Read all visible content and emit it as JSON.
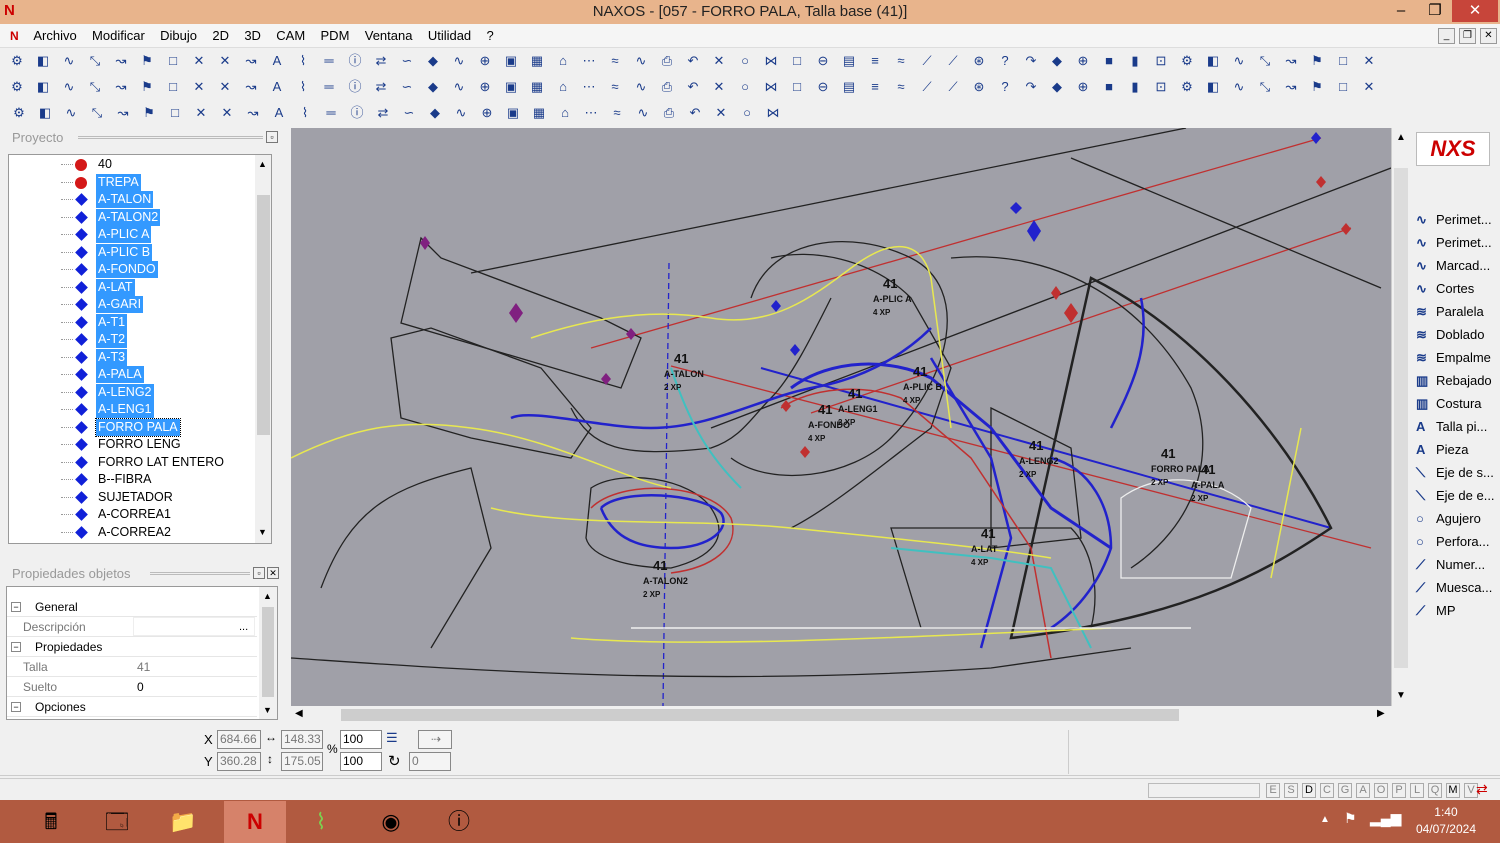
{
  "window": {
    "title": "NAXOS - [057 - FORRO PALA, Talla base (41)]",
    "app_logo": "N"
  },
  "menu": [
    "Archivo",
    "Modificar",
    "Dibujo",
    "2D",
    "3D",
    "CAM",
    "PDM",
    "Ventana",
    "Utilidad",
    "?"
  ],
  "project_panel": {
    "title": "Proyecto"
  },
  "tree": [
    {
      "label": "40",
      "icon": "red-dot",
      "selected": false
    },
    {
      "label": "TREPA",
      "icon": "red-dot",
      "selected": true
    },
    {
      "label": "A-TALON",
      "icon": "blue-diamond",
      "selected": true
    },
    {
      "label": "A-TALON2",
      "icon": "blue-diamond",
      "selected": true
    },
    {
      "label": "A-PLIC A",
      "icon": "blue-diamond",
      "selected": true
    },
    {
      "label": "A-PLIC B",
      "icon": "blue-diamond",
      "selected": true
    },
    {
      "label": "A-FONDO",
      "icon": "blue-diamond",
      "selected": true
    },
    {
      "label": "A-LAT",
      "icon": "blue-diamond",
      "selected": true
    },
    {
      "label": "A-GARI",
      "icon": "blue-diamond",
      "selected": true
    },
    {
      "label": "A-T1",
      "icon": "blue-diamond",
      "selected": true
    },
    {
      "label": "A-T2",
      "icon": "blue-diamond",
      "selected": true
    },
    {
      "label": "A-T3",
      "icon": "blue-diamond",
      "selected": true
    },
    {
      "label": "A-PALA",
      "icon": "blue-diamond",
      "selected": true
    },
    {
      "label": "A-LENG2",
      "icon": "blue-diamond",
      "selected": true
    },
    {
      "label": "A-LENG1",
      "icon": "blue-diamond",
      "selected": true
    },
    {
      "label": "FORRO PALA",
      "icon": "blue-diamond",
      "selected": true,
      "focus": true
    },
    {
      "label": "FORRO LENG",
      "icon": "blue-diamond",
      "selected": false
    },
    {
      "label": "FORRO LAT ENTERO",
      "icon": "blue-diamond",
      "selected": false
    },
    {
      "label": "B--FIBRA",
      "icon": "blue-diamond",
      "selected": false
    },
    {
      "label": "SUJETADOR",
      "icon": "blue-diamond",
      "selected": false
    },
    {
      "label": "A-CORREA1",
      "icon": "blue-diamond",
      "selected": false
    },
    {
      "label": "A-CORREA2",
      "icon": "blue-diamond",
      "selected": false
    }
  ],
  "properties_panel": {
    "title": "Propiedades objetos",
    "general": "General",
    "descripcion_label": "Descripción",
    "descripcion_value": "",
    "propiedades": "Propiedades",
    "talla_label": "Talla",
    "talla_value": "41",
    "suelto_label": "Suelto",
    "suelto_value": "0",
    "opciones": "Opciones"
  },
  "canvas_labels": [
    {
      "size": "41",
      "name": "A-TALON",
      "qty": "2 XP"
    },
    {
      "size": "41",
      "name": "A-PLIC A",
      "qty": "4 XP"
    },
    {
      "size": "41",
      "name": "A-PLIC B",
      "qty": "4 XP"
    },
    {
      "size": "41",
      "name": "A-LENG1",
      "qty": "2 XP"
    },
    {
      "size": "41",
      "name": "A-FONDO",
      "qty": "4 XP"
    },
    {
      "size": "41",
      "name": "A-LENG2",
      "qty": "2 XP"
    },
    {
      "size": "41",
      "name": "FORRO PALA",
      "qty": "2 XP"
    },
    {
      "size": "41",
      "name": "A-PALA",
      "qty": "2 XP"
    },
    {
      "size": "41",
      "name": "A-LAT",
      "qty": "4 XP"
    },
    {
      "size": "41",
      "name": "A-TALON2",
      "qty": "2 XP"
    }
  ],
  "right_panel": {
    "logo": "NXS",
    "items": [
      {
        "label": "Perimet...",
        "icon": "curve-icon"
      },
      {
        "label": "Perimet...",
        "icon": "curve-icon"
      },
      {
        "label": "Marcad...",
        "icon": "curve-icon"
      },
      {
        "label": "Cortes",
        "icon": "curve-icon"
      },
      {
        "label": "Paralela",
        "icon": "parallel-icon"
      },
      {
        "label": "Doblado",
        "icon": "parallel-icon"
      },
      {
        "label": "Empalme",
        "icon": "parallel-icon"
      },
      {
        "label": "Rebajado",
        "icon": "bars-icon"
      },
      {
        "label": "Costura",
        "icon": "bars-icon"
      },
      {
        "label": "Talla pi...",
        "icon": "text-icon"
      },
      {
        "label": "Pieza",
        "icon": "text-icon"
      },
      {
        "label": "Eje de s...",
        "icon": "axis-icon"
      },
      {
        "label": "Eje de e...",
        "icon": "axis-icon"
      },
      {
        "label": "Agujero",
        "icon": "circle-icon"
      },
      {
        "label": "Perfora...",
        "icon": "circle-icon"
      },
      {
        "label": "Numer...",
        "icon": "pen-icon"
      },
      {
        "label": "Muesca...",
        "icon": "pen-icon"
      },
      {
        "label": "MP",
        "icon": "pen-icon"
      }
    ]
  },
  "coords": {
    "x_label": "X",
    "y_label": "Y",
    "x": "684.66",
    "y": "360.28",
    "dx": "148.33",
    "dy": "175.05",
    "scale_x": "100",
    "scale_y": "100",
    "percent": "%",
    "rotation": "0"
  },
  "status_letters": [
    "E",
    "S",
    "D",
    "C",
    "G",
    "A",
    "O",
    "P",
    "L",
    "Q",
    "M",
    "V"
  ],
  "taskbar": {
    "time": "1:40",
    "date": "04/07/2024"
  }
}
